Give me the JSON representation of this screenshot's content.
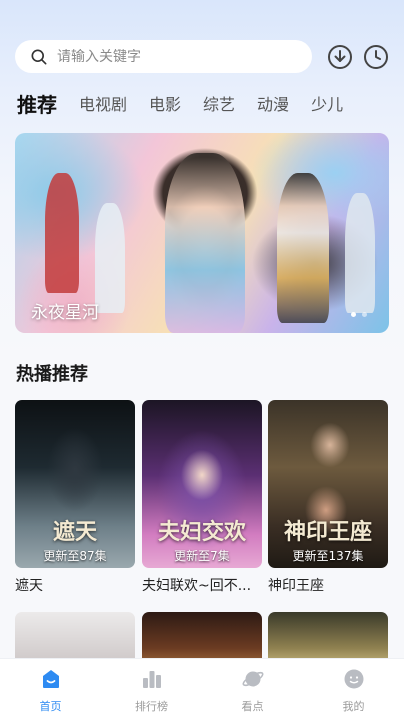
{
  "search": {
    "placeholder": "请输入关键字"
  },
  "header_icons": [
    "download-icon",
    "history-icon"
  ],
  "tabs": [
    {
      "label": "推荐",
      "active": true
    },
    {
      "label": "电视剧"
    },
    {
      "label": "电影"
    },
    {
      "label": "综艺"
    },
    {
      "label": "动漫"
    },
    {
      "label": "少儿"
    }
  ],
  "banner": {
    "title": "永夜星河",
    "slide_count": 2,
    "active_slide": 1
  },
  "section": {
    "title": "热播推荐"
  },
  "cards": [
    {
      "title": "遮天",
      "episodes": "更新至87集",
      "logo": "遮天"
    },
    {
      "title": "夫妇联欢~回不...",
      "episodes": "更新至7集",
      "logo": "夫妇交欢"
    },
    {
      "title": "神印王座",
      "episodes": "更新至137集",
      "logo": "神印王座"
    }
  ],
  "nav": [
    {
      "label": "首页",
      "icon": "home-icon",
      "active": true
    },
    {
      "label": "排行榜",
      "icon": "ranking-icon"
    },
    {
      "label": "看点",
      "icon": "planet-icon"
    },
    {
      "label": "我的",
      "icon": "profile-icon"
    }
  ],
  "colors": {
    "accent": "#2e8bf2",
    "inactive": "#9a9a9a",
    "background_top": "#d9e6fb"
  }
}
